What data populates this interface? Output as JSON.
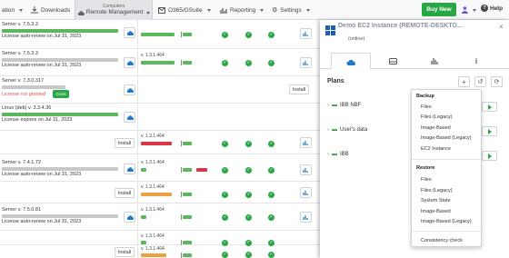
{
  "nav": {
    "items": [
      {
        "label": "ation"
      },
      {
        "label": "Downloads",
        "icon": "download-icon"
      },
      {
        "sub": "Computers",
        "label": "Remote Management",
        "icon": "cloud-icon"
      },
      {
        "label": "O365/GSuite",
        "icon": "envelope-icon"
      },
      {
        "label": "Reporting",
        "icon": "bar-chart-icon"
      },
      {
        "label": "Settings",
        "icon": "gear-icon"
      }
    ],
    "buy_new": "Buy New",
    "help": "Help"
  },
  "rows": [
    {
      "name": "Server v. 7.5.3.3",
      "license": "License auto-renew on Jul 31, 2023"
    },
    {
      "name": "Server v. 7.5.3.3",
      "license": "License auto-renew on Jul 31, 2023",
      "version": "v. 1.3.1.464"
    },
    {
      "name": "Server v. 7.3.0.317",
      "license": "License not granted",
      "grant": "Grant",
      "install": "Install"
    },
    {
      "name": "Linux (deb) v. 3.3.4.36",
      "license": "License expires on Jul 31, 2023"
    },
    {
      "install": "Install",
      "version": "v. 1.3.1.464"
    },
    {
      "name": "Server v. 7.4.1.72",
      "license": "License auto-renew on Jul 31, 2023",
      "version": "v. 1.3.1.464"
    },
    {
      "install": "Install",
      "version": "v. 1.3.1.464"
    },
    {
      "name": "Server v. 7.5.0.81",
      "license": "License auto-renew on Jul 31, 2023",
      "version": "v. 1.3.1.464"
    },
    {
      "install": "Install",
      "version": "v. 1.3.1.464"
    },
    {
      "install": "Install",
      "version": "v. 1.3.1.464"
    }
  ],
  "panel": {
    "title": "Demo EC2 Instance (REMOTE-DESKTO...",
    "status": "(online)",
    "close": "×",
    "tabs": [
      "cloud-icon",
      "drive-icon",
      "bar-chart-icon",
      "info-icon"
    ],
    "plans_heading": "Plans",
    "plans": [
      "IBB NBF",
      "User's data",
      "IBB"
    ],
    "menu": {
      "backup_heading": "Backup",
      "backup_items": [
        "Files",
        "Files (Legacy)",
        "Image-Based",
        "Image-Based (Legacy)",
        "EC2 Instance"
      ],
      "restore_heading": "Restore",
      "restore_items": [
        "Files",
        "Files (Legacy)",
        "System State",
        "Image-Based",
        "Image-Based (Legacy)"
      ],
      "consistency": "Consistency check"
    }
  },
  "colors": {
    "green": "#28a745",
    "red": "#dc3545",
    "orange": "#f0a040",
    "blue": "#1f78c8"
  }
}
